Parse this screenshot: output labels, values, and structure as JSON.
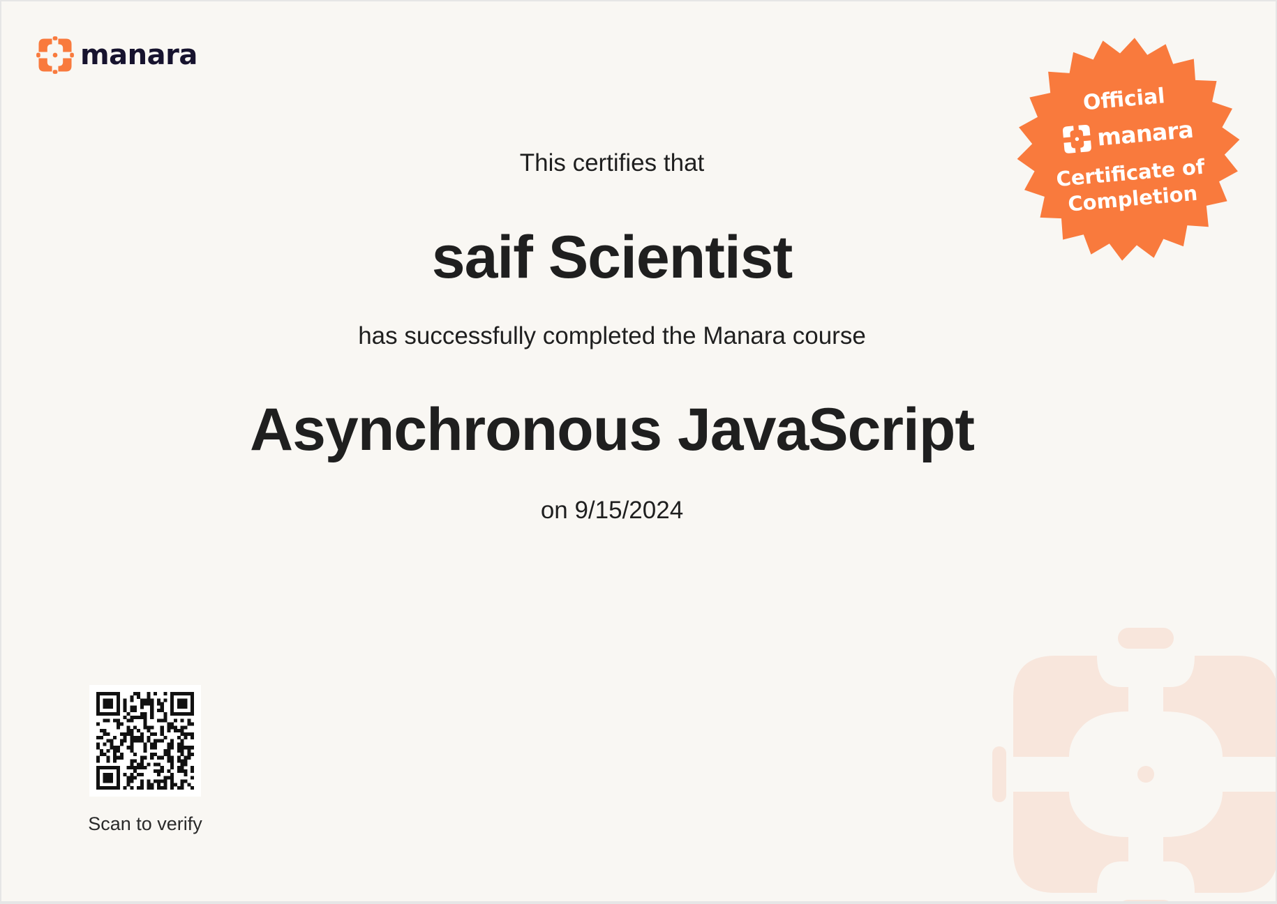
{
  "brand": {
    "name": "manara",
    "logo_icon": "manara-flower-icon",
    "accent_color": "#f97a3d",
    "ink_color": "#17132e"
  },
  "certificate": {
    "intro": "This certifies that",
    "recipient": "saif Scientist",
    "completion_text": "has successfully completed the Manara course",
    "course": "Asynchronous JavaScript",
    "date_line": "on 9/15/2024"
  },
  "seal": {
    "line1": "Official",
    "brand": "manara",
    "line3": "Certificate of",
    "line4": "Completion",
    "color": "#f97a3d"
  },
  "verification": {
    "caption": "Scan to verify",
    "qr_icon": "qr-code-icon"
  },
  "watermark": {
    "icon": "manara-flower-watermark-icon",
    "color": "#f8e6dc"
  }
}
